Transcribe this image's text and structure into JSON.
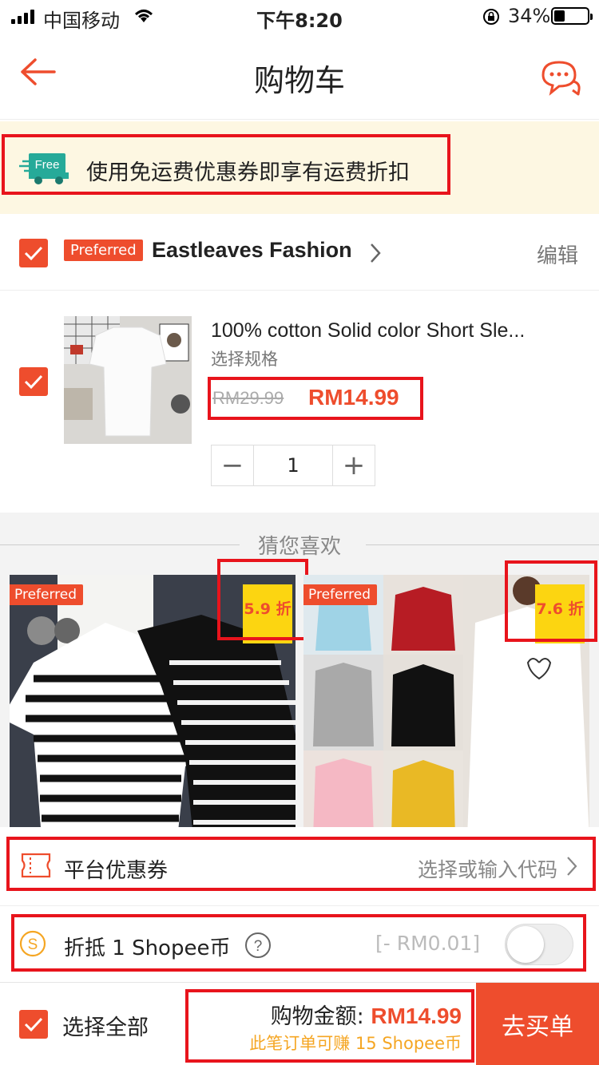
{
  "status_bar": {
    "carrier": "中国移动",
    "time": "下午8:20",
    "battery": "34%"
  },
  "header": {
    "title": "购物车"
  },
  "shipping_banner": {
    "text": "使用免运费优惠券即享有运费折扣",
    "icon_label": "Free"
  },
  "shop": {
    "preferred_tag": "Preferred",
    "name": "Eastleaves Fashion",
    "edit_label": "编辑"
  },
  "cart_item": {
    "name": "100% cotton Solid color Short Sle...",
    "variant": "选择规格",
    "original_price": "RM29.99",
    "price": "RM14.99",
    "quantity": "1"
  },
  "recommendations": {
    "title": "猜您喜欢",
    "items": [
      {
        "preferred_tag": "Preferred",
        "discount": "5.9 折"
      },
      {
        "preferred_tag": "Preferred",
        "discount": "7.6 折"
      }
    ]
  },
  "platform_voucher": {
    "label": "平台优惠券",
    "action": "选择或输入代码"
  },
  "coins": {
    "label": "折抵 1 Shopee币",
    "amount": "[- RM0.01]",
    "icon": "S"
  },
  "bottom_bar": {
    "select_all": "选择全部",
    "total_label": "购物金额: ",
    "total_value": "RM14.99",
    "coins_earn": "此笔订单可赚 15 Shopee币",
    "checkout": "去买单"
  },
  "colors": {
    "accent": "#ee4d2d",
    "highlight": "#e8141c",
    "discount_tag": "#fcd511",
    "banner_bg": "#fdf7e2"
  }
}
